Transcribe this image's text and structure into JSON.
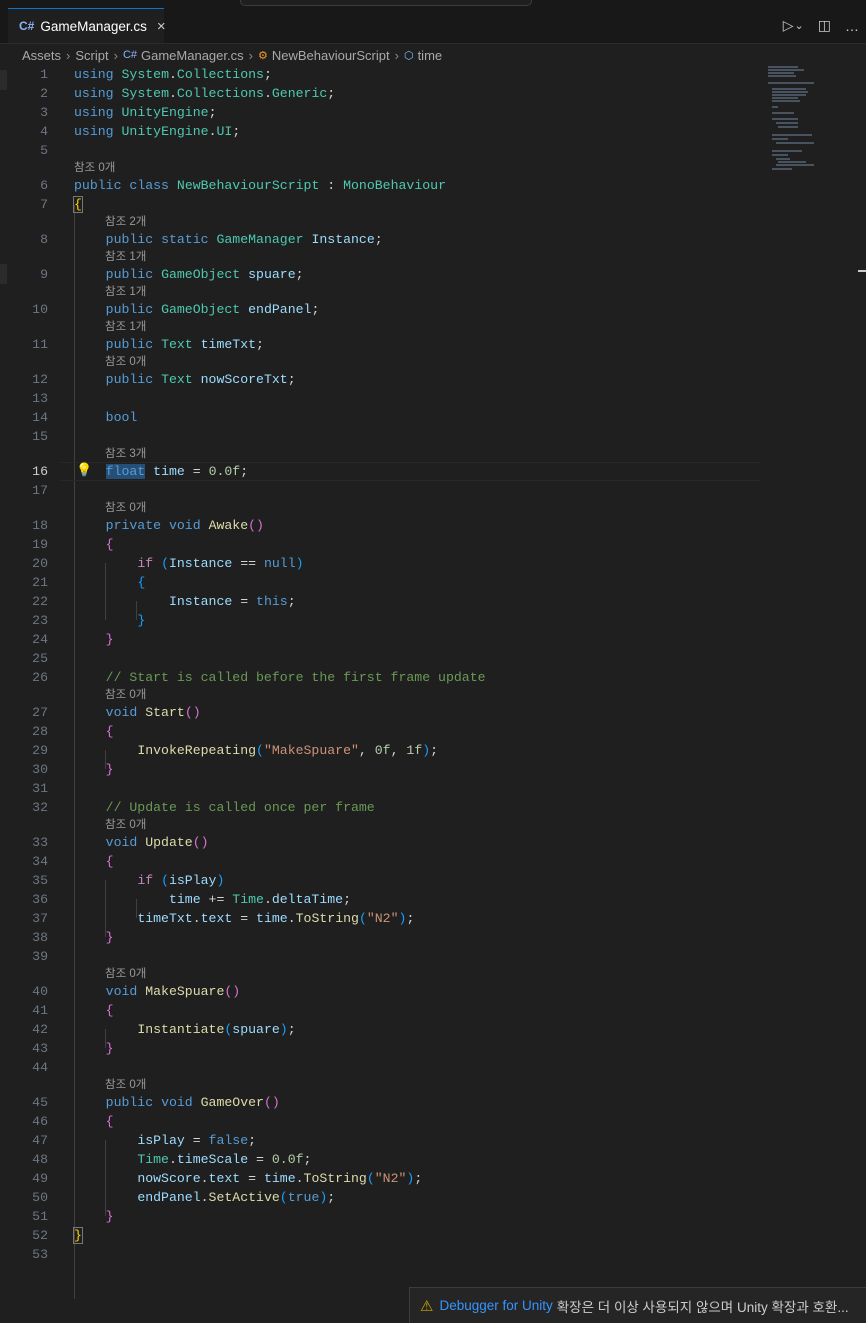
{
  "tab": {
    "icon": "csharp-file-icon",
    "filename": "GameManager.cs",
    "close": "×"
  },
  "toolbar": {
    "run": "▷",
    "run_menu": "⌄",
    "split": "◫",
    "more": "…"
  },
  "breadcrumbs": {
    "items": [
      "Assets",
      "Script",
      "GameManager.cs",
      "NewBehaviourScript",
      "time"
    ],
    "separator": "›"
  },
  "codelens": {
    "l6": "참조 0개",
    "l8": "참조 2개",
    "l9": "참조 1개",
    "l10": "참조 1개",
    "l11": "참조 1개",
    "l12": "참조 0개",
    "l16": "참조 3개",
    "l18": "참조 0개",
    "l27": "참조 0개",
    "l33": "참조 0개",
    "l40": "참조 0개",
    "l45": "참조 0개"
  },
  "editor": {
    "current_line": 16,
    "total_lines": 53
  },
  "notification": {
    "icon": "warning-icon",
    "link": "Debugger for Unity",
    "message": "확장은 더 이상 사용되지 않으며 Unity 확장과 호환..."
  }
}
